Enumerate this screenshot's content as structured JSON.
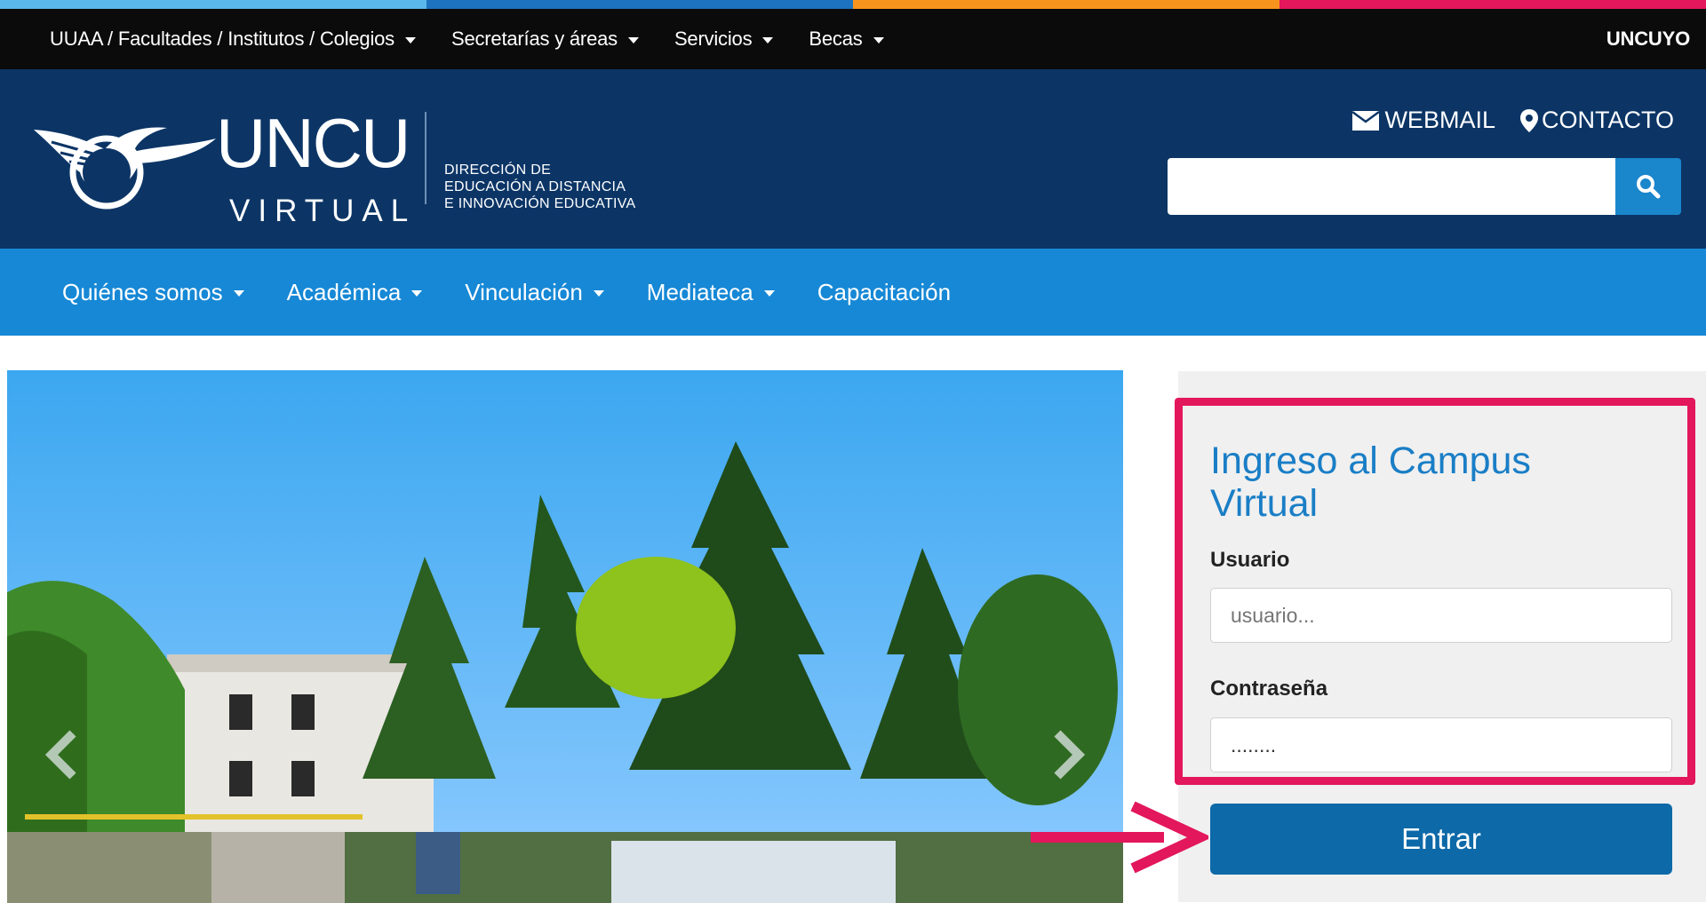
{
  "colors": {
    "bar": [
      "#5ab9ea",
      "#1e73be",
      "#f7941d",
      "#e3175b"
    ],
    "topbar_bg": "#0b0b0b",
    "header_bg": "#0c3566",
    "nav_bg": "#1688d6",
    "accent_title": "#1a7ec6",
    "button": "#0d69a8",
    "highlight": "#e3175b"
  },
  "topbar": {
    "items": [
      {
        "label": "UUAA / Facultades / Institutos / Colegios"
      },
      {
        "label": "Secretarías y áreas"
      },
      {
        "label": "Servicios"
      },
      {
        "label": "Becas"
      }
    ],
    "brand": "UNCUYO"
  },
  "header": {
    "logo_main": "UNCU",
    "logo_sub": "VIRTUAL",
    "dept_line1": "Dirección de",
    "dept_line2": "Educación a Distancia",
    "dept_line3": "e Innovación Educativa",
    "webmail": "WEBMAIL",
    "contacto": "CONTACTO",
    "search_placeholder": ""
  },
  "nav": {
    "items": [
      {
        "label": "Quiénes somos"
      },
      {
        "label": "Académica"
      },
      {
        "label": "Vinculación"
      },
      {
        "label": "Mediateca"
      },
      {
        "label": "Capacitación"
      }
    ]
  },
  "login": {
    "title": "Ingreso al Campus Virtual",
    "user_label": "Usuario",
    "user_placeholder": "usuario...",
    "pass_label": "Contraseña",
    "pass_value": "........",
    "submit": "Entrar"
  },
  "slider": {
    "prev_icon": "chevron-left-icon",
    "next_icon": "chevron-right-icon"
  }
}
